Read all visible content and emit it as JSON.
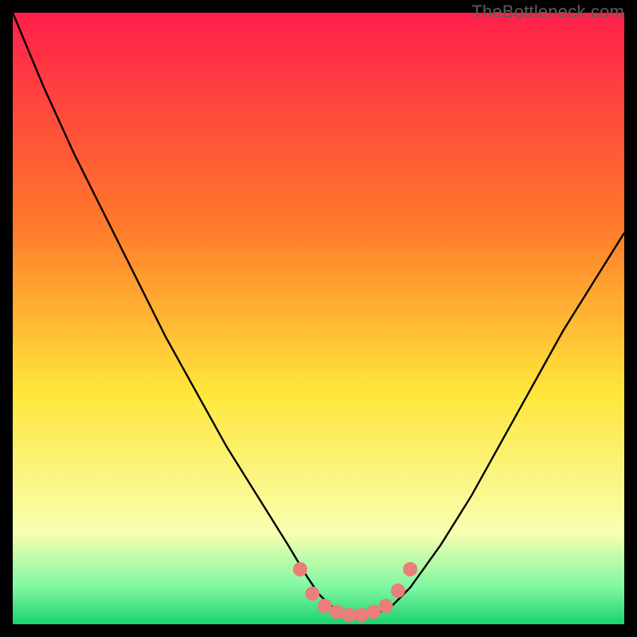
{
  "watermark": "TheBottleneck.com",
  "colors": {
    "frame": "#000000",
    "gradient_top": "#ff1f4b",
    "gradient_mid1": "#ff7a2a",
    "gradient_mid2": "#ffe63a",
    "gradient_low1": "#f8ffb0",
    "gradient_low2": "#7ef7a1",
    "gradient_bottom": "#18d36b",
    "curve": "#000000",
    "dots": "#e97e7a"
  },
  "chart_data": {
    "type": "line",
    "title": "",
    "xlabel": "",
    "ylabel": "",
    "xlim": [
      0,
      100
    ],
    "ylim": [
      0,
      100
    ],
    "series": [
      {
        "name": "bottleneck-curve",
        "x": [
          0,
          5,
          10,
          15,
          20,
          25,
          30,
          35,
          40,
          45,
          48,
          50,
          52,
          54,
          56,
          58,
          60,
          62,
          65,
          70,
          75,
          80,
          85,
          90,
          95,
          100
        ],
        "values": [
          100,
          88,
          77,
          67,
          57,
          47,
          38,
          29,
          21,
          13,
          8,
          5,
          3,
          2,
          1.5,
          1.5,
          2,
          3,
          6,
          13,
          21,
          30,
          39,
          48,
          56,
          64
        ]
      }
    ],
    "markers": [
      {
        "name": "dot-left-upper",
        "x": 47,
        "y": 9
      },
      {
        "name": "dot-left-mid",
        "x": 49,
        "y": 5
      },
      {
        "name": "dot-left-low",
        "x": 51,
        "y": 3
      },
      {
        "name": "dot-bottom-1",
        "x": 53,
        "y": 2
      },
      {
        "name": "dot-bottom-2",
        "x": 55,
        "y": 1.5
      },
      {
        "name": "dot-bottom-3",
        "x": 57,
        "y": 1.5
      },
      {
        "name": "dot-bottom-4",
        "x": 59,
        "y": 2
      },
      {
        "name": "dot-right-low",
        "x": 61,
        "y": 3
      },
      {
        "name": "dot-right-mid",
        "x": 63,
        "y": 5.5
      },
      {
        "name": "dot-right-upper",
        "x": 65,
        "y": 9
      }
    ]
  }
}
